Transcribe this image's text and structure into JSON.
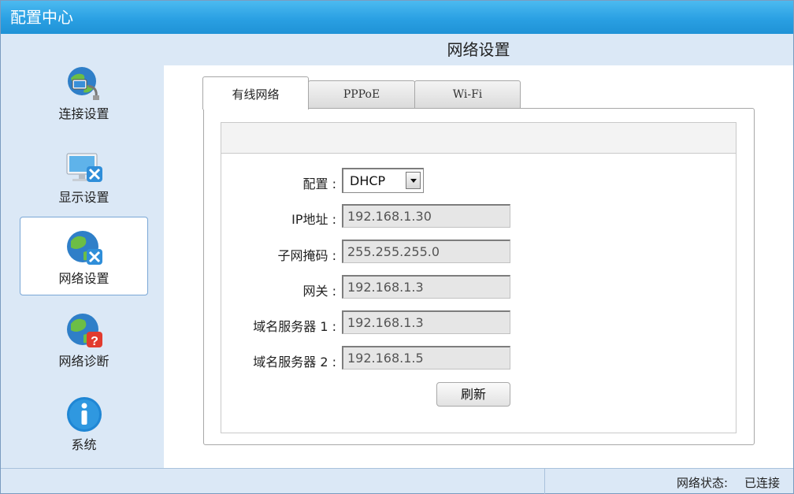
{
  "window": {
    "title": "配置中心"
  },
  "sidebar": {
    "items": [
      {
        "label": "连接设置",
        "icon": "globe-connect-icon",
        "active": false
      },
      {
        "label": "显示设置",
        "icon": "monitor-tools-icon",
        "active": false
      },
      {
        "label": "网络设置",
        "icon": "globe-tools-icon",
        "active": true
      },
      {
        "label": "网络诊断",
        "icon": "globe-help-icon",
        "active": false
      },
      {
        "label": "系统",
        "icon": "info-icon",
        "active": false
      }
    ]
  },
  "main": {
    "title": "网络设置",
    "tabs": [
      {
        "label": "有线网络",
        "active": true
      },
      {
        "label": "PPPoE",
        "active": false
      },
      {
        "label": "Wi-Fi",
        "active": false
      }
    ],
    "form": {
      "config_label": "配置 :",
      "config_value": "DHCP",
      "ip_label": "IP地址 :",
      "ip_value": "192.168.1.30",
      "mask_label": "子网掩码 :",
      "mask_value": "255.255.255.0",
      "gateway_label": "网关 :",
      "gateway_value": "192.168.1.3",
      "dns1_label": "域名服务器 1 :",
      "dns1_value": "192.168.1.3",
      "dns2_label": "域名服务器 2 :",
      "dns2_value": "192.168.1.5",
      "refresh_label": "刷新"
    }
  },
  "status": {
    "label": "网络状态:",
    "value": "已连接"
  },
  "colors": {
    "titlebar": "#2aa0e3",
    "panel_bg": "#dbe8f6",
    "active_border": "#7aa7d6"
  }
}
